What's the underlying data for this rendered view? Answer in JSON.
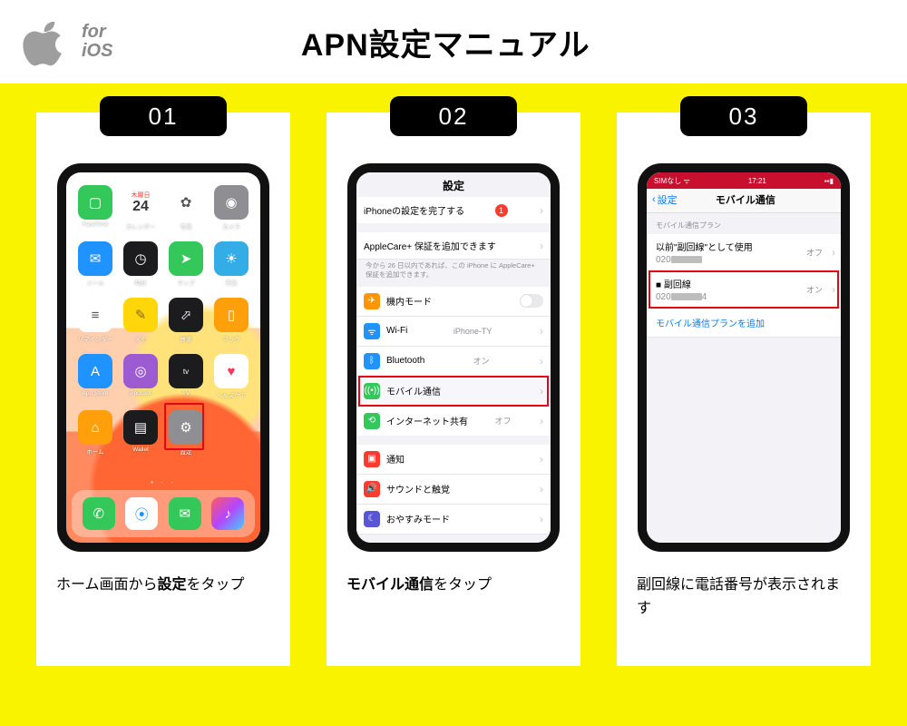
{
  "header": {
    "for": "for",
    "ios": "iOS",
    "title": "APN設定マニュアル"
  },
  "steps": {
    "s1": {
      "num": "01",
      "caption_a": "ホーム画面から",
      "caption_b": "設定",
      "caption_c": "をタップ"
    },
    "s2": {
      "num": "02",
      "caption_a": "",
      "caption_b": "モバイル通信",
      "caption_c": "をタップ"
    },
    "s3": {
      "num": "03",
      "caption": "副回線に電話番号が表示されます"
    }
  },
  "home": {
    "day_label": "木曜日",
    "day_num": "24",
    "apps": {
      "facetime": "FaceTime",
      "calendar": "カレンダー",
      "photos": "写真",
      "camera": "カメラ",
      "mail": "メール",
      "clock": "時計",
      "maps": "マップ",
      "weather": "天気",
      "reminders": "リマインダー",
      "notes": "メモ",
      "stocks": "株価",
      "books": "ブック",
      "appstore": "App Store",
      "podcast": "Podcast",
      "tv": "TV",
      "health": "ヘルスケア",
      "home_app": "ホーム",
      "wallet": "Wallet",
      "settings": "設定"
    }
  },
  "settings": {
    "title": "設定",
    "finish_setup": "iPhoneの設定を完了する",
    "badge1": "1",
    "applecare": "AppleCare+ 保証を追加できます",
    "applecare_note": "今から 26 日以内であれば、この iPhone に AppleCare+ 保証を追加できます。",
    "airplane": "機内モード",
    "wifi": "Wi-Fi",
    "wifi_val": "iPhone-TY",
    "bt": "Bluetooth",
    "bt_val": "オン",
    "cellular": "モバイル通信",
    "hotspot": "インターネット共有",
    "hotspot_val": "オフ",
    "notif": "通知",
    "sound": "サウンドと触覚",
    "dnd": "おやすみモード"
  },
  "cellular": {
    "status_left": "SIMなし",
    "status_time": "17:21",
    "back": "設定",
    "title": "モバイル通信",
    "section": "モバイル通信プラン",
    "plan1_title": "以前\"副回線\"として使用",
    "plan1_num_prefix": "020",
    "plan1_val": "オフ",
    "plan2_title_prefix": "■ 副回線",
    "plan2_num_prefix": "020",
    "plan2_num_suffix": "4",
    "plan2_val": "オン",
    "add_plan": "モバイル通信プランを追加"
  }
}
